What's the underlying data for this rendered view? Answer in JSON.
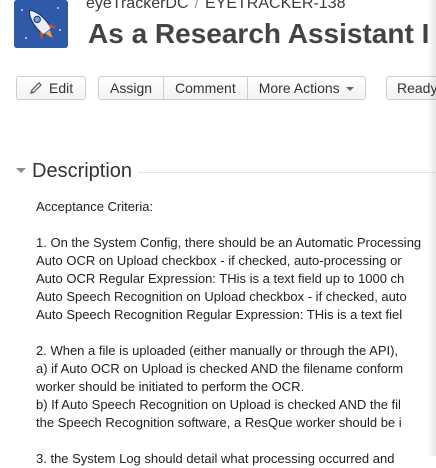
{
  "breadcrumb": {
    "project": "eyeTrackerDC",
    "separator": "/",
    "issue_key": "EYETRACKER-138"
  },
  "issue": {
    "title": "As a Research Assistant I"
  },
  "toolbar": {
    "edit_label": "Edit",
    "assign_label": "Assign",
    "comment_label": "Comment",
    "more_actions_label": "More Actions",
    "ready_label": "Ready"
  },
  "description": {
    "heading": "Description",
    "lines": [
      "Acceptance Criteria:",
      "",
      "1. On the System Config, there should be an Automatic Processing",
      "Auto OCR on Upload checkbox - if checked, auto-processing or",
      "Auto OCR Regular Expression: THis is a text field up to 1000 ch",
      "Auto Speech Recognition on Upload checkbox - if checked, auto",
      "Auto Speech Recognition Regular Expression: THis is a text fiel",
      "",
      "2. When a file is uploaded (either manually or through the API),",
      "a) if Auto OCR on Upload is checked AND the filename conform",
      "worker should be initiated to perform the OCR.",
      "b) If Auto Speech Recognition on Upload is checked AND the fil",
      "the Speech Recognition software, a ResQue worker should be i",
      "",
      "3. the System Log should detail what processing occurred and"
    ]
  },
  "colors": {
    "avatar_bg": "#2f5aa8",
    "title_text": "#444444",
    "button_border": "#cfcfcf"
  },
  "icons": {
    "avatar": "rocket-icon",
    "edit": "pencil-icon",
    "more_actions": "chevron-down-icon",
    "section_toggle": "twixie-down-icon"
  }
}
